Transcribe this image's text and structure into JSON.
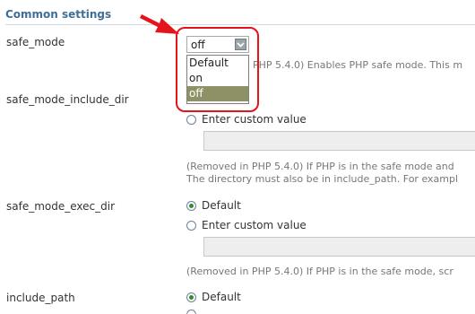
{
  "section": {
    "title": "Common settings"
  },
  "safe_mode": {
    "label": "safe_mode",
    "select_value": "off",
    "options": [
      "Default",
      "on",
      "off"
    ],
    "help_visible": "PHP 5.4.0) Enables PHP safe mode. This m"
  },
  "safe_mode_include_dir": {
    "label": "safe_mode_include_dir",
    "custom_label": "Enter custom value",
    "help_line1": "(Removed in PHP 5.4.0) If PHP is in the safe mode and",
    "help_line2": "The directory must also be in include_path. For exampl"
  },
  "safe_mode_exec_dir": {
    "label": "safe_mode_exec_dir",
    "default_label": "Default",
    "custom_label": "Enter custom value",
    "help_line1": "(Removed in PHP 5.4.0) If PHP is in the safe mode, scr"
  },
  "include_path": {
    "label": "include_path",
    "default_label": "Default"
  },
  "colors": {
    "section_title": "#3f6f96",
    "highlight": "#e4141b",
    "selected_option": "#8d9165",
    "radio_checked": "#2d8f2d"
  },
  "icons": {
    "annotation": "red-arrow-icon",
    "dropdown": "chevron-down-icon"
  }
}
